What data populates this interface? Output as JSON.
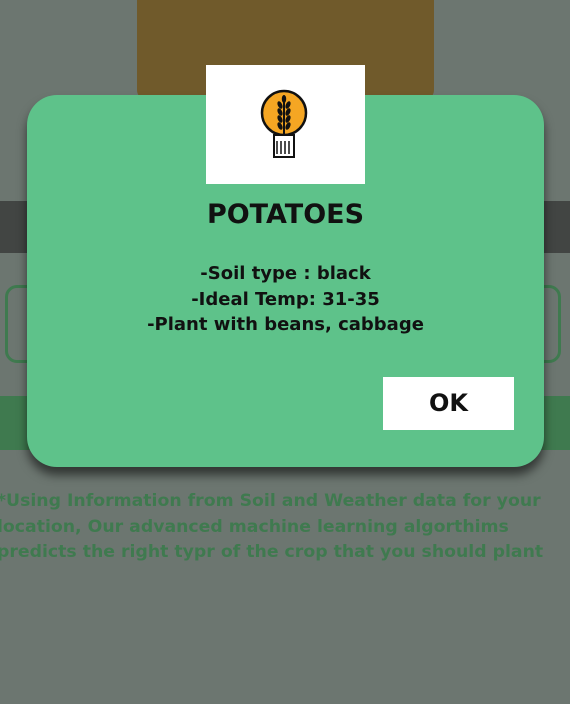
{
  "background": {
    "info_lines": [
      "*Using Information from Soil and Weather data for your",
      "location, Our advanced machine learning algorthims",
      "predicts the right typr of the crop that you should plant"
    ]
  },
  "dialog": {
    "logo_icon": "wheat-bulb-icon",
    "title": "POTATOES",
    "details": [
      "-Soil type : black",
      "-Ideal Temp: 31-35",
      "-Plant with beans, cabbage"
    ],
    "ok_label": "OK"
  },
  "colors": {
    "dialog_bg": "#5ec28a",
    "overlay": "#6c7670",
    "accent_green": "#3f7a4f",
    "header_brown": "#705a2b",
    "logo_orange": "#f5a623"
  }
}
